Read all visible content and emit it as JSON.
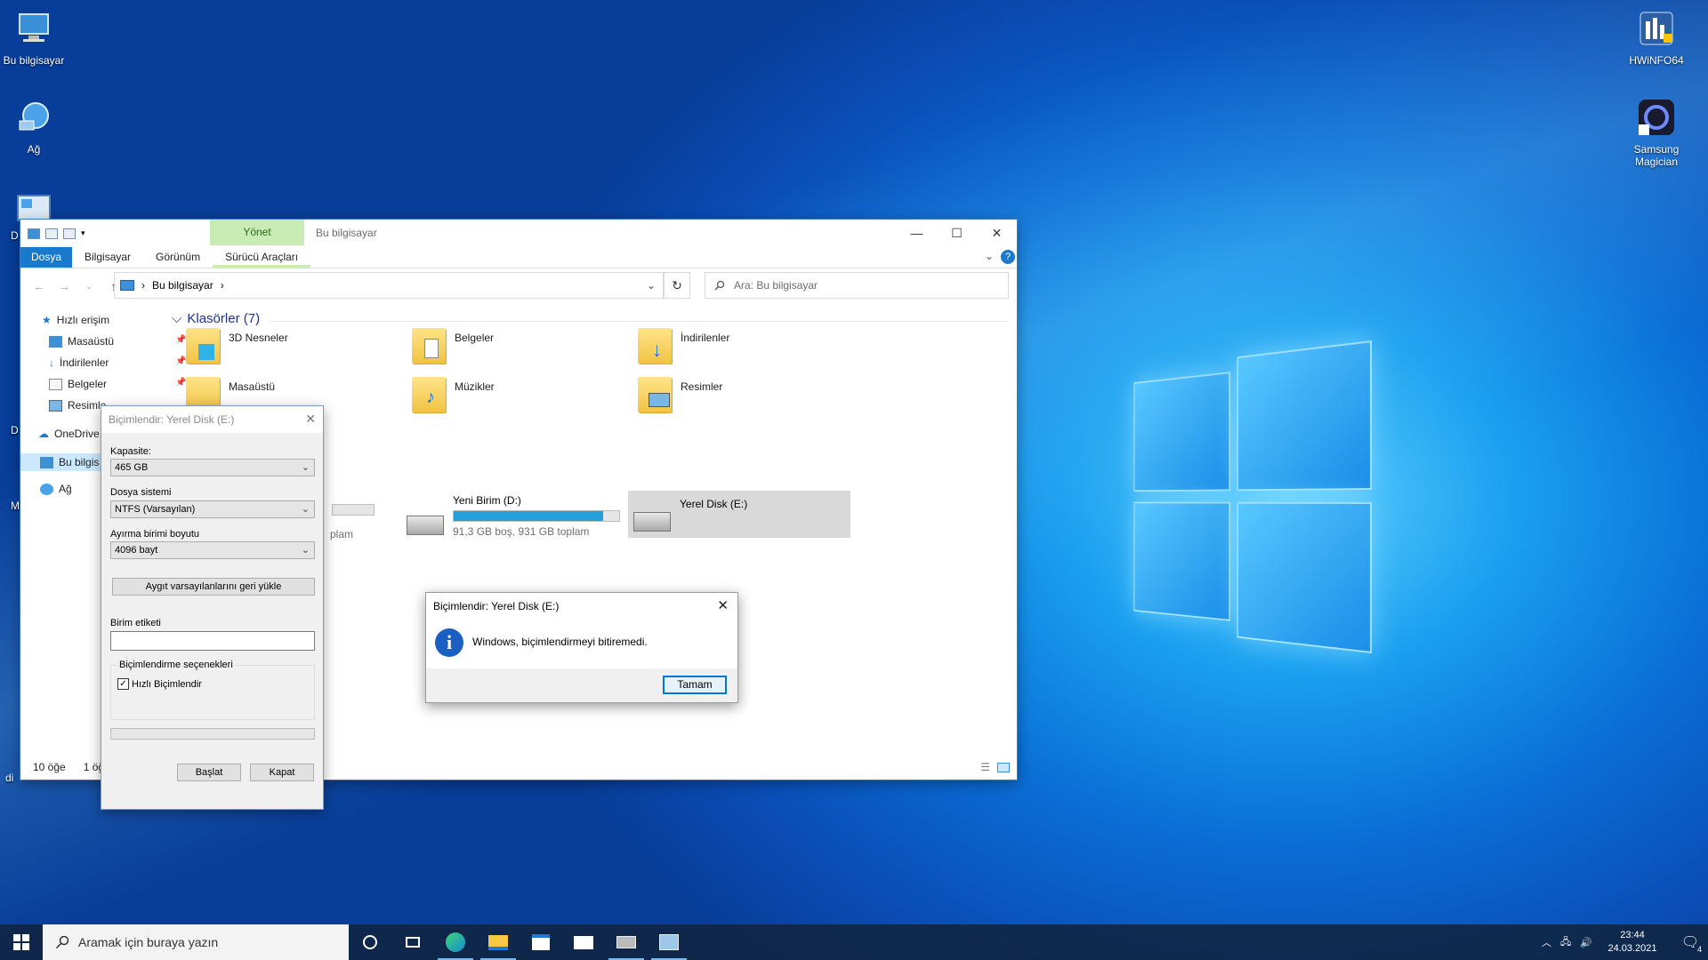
{
  "desktop": {
    "icons": [
      {
        "label": "Bu bilgisayar"
      },
      {
        "label": "Ağ"
      },
      {
        "label": "HWiNFO64"
      },
      {
        "label": "Samsung Magician"
      }
    ],
    "partial_labels": [
      "D",
      "D",
      "M",
      "di"
    ]
  },
  "explorer": {
    "title": "Bu bilgisayar",
    "context_tab": "Yönet",
    "tabs": [
      "Dosya",
      "Bilgisayar",
      "Görünüm",
      "Sürücü Araçları"
    ],
    "breadcrumb": "Bu bilgisayar",
    "search_placeholder": "Ara: Bu bilgisayar",
    "nav": {
      "quick": "Hızlı erişim",
      "desktop": "Masaüstü",
      "downloads": "İndirilenler",
      "docs": "Belgeler",
      "pics": "Resimle",
      "onedrive": "OneDrive",
      "thispc": "Bu bilgis",
      "network": "Ağ"
    },
    "group": "Klasörler (7)",
    "folders": [
      "3D Nesneler",
      "Belgeler",
      "İndirilenler",
      "Masaüstü",
      "Müzikler",
      "Resimler"
    ],
    "drive_c_partial": "plam",
    "drive_d": {
      "name": "Yeni Birim (D:)",
      "info": "91,3 GB boş, 931 GB toplam",
      "used": 0.902
    },
    "drive_e": {
      "name": "Yerel Disk (E:)"
    },
    "status_items": "10 öğe",
    "status_sel": "1 öğ"
  },
  "format_dialog": {
    "title": "Biçimlendir: Yerel Disk (E:)",
    "capacity_label": "Kapasite:",
    "capacity": "465 GB",
    "fs_label": "Dosya sistemi",
    "fs": "NTFS (Varsayılan)",
    "alloc_label": "Ayırma birimi boyutu",
    "alloc": "4096 bayt",
    "restore": "Aygıt varsayılanlarını geri yükle",
    "volume_label": "Birim etiketi",
    "volume_value": "",
    "options": "Biçimlendirme seçenekleri",
    "quick": "Hızlı Biçimlendir",
    "quick_checked": true,
    "start": "Başlat",
    "close": "Kapat"
  },
  "message": {
    "title": "Biçimlendir: Yerel Disk (E:)",
    "text": "Windows, biçimlendirmeyi bitiremedi.",
    "ok": "Tamam"
  },
  "taskbar": {
    "search": "Aramak için buraya yazın",
    "time": "23:44",
    "date": "24.03.2021",
    "notif_count": "4"
  }
}
